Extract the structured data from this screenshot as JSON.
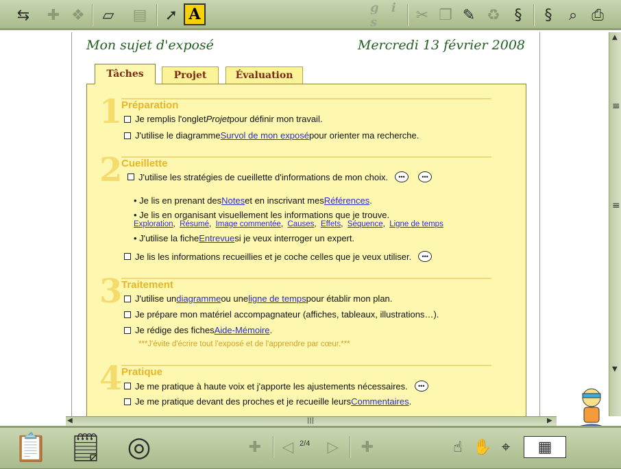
{
  "header": {
    "title": "Mon sujet d'exposé",
    "date": "Mercredi 13 février 2008"
  },
  "toolbar": {
    "highlight_label": "A",
    "format_label": "g i s"
  },
  "tabs": [
    {
      "label": "Tâches"
    },
    {
      "label": "Projet"
    },
    {
      "label": "Évaluation"
    }
  ],
  "sections": {
    "s1": {
      "num": "1",
      "title": "Préparation",
      "l1": {
        "a": "Je remplis l'onglet ",
        "b": "Projet",
        "c": " pour définir mon travail."
      },
      "l2": {
        "a": "J'utilise le diagramme ",
        "link": "Survol de mon exposé",
        "c": " pour orienter ma recherche."
      }
    },
    "s2": {
      "num": "2",
      "title": "Cueillette",
      "l1": "J'utilise les stratégies de cueillette d'informations de mon choix.",
      "b1": {
        "a": "• Je lis en prenant des ",
        "link1": "Notes",
        "b": " et en inscrivant mes ",
        "link2": "Références",
        "c": "."
      },
      "b2": "• Je lis en organisant visuellement les informations que je trouve.",
      "links": [
        "Exploration",
        "Résumé",
        "Image commentée",
        "Causes",
        "Effets",
        "Séquence",
        "Ligne de temps"
      ],
      "b3": {
        "a": "• J'utilise la fiche ",
        "link": "Entrevue",
        "c": " si je veux interroger un expert."
      },
      "l2": "Je lis les informations recueillies et je coche celles que je veux utiliser."
    },
    "s3": {
      "num": "3",
      "title": "Traitement",
      "l1": {
        "a": "J'utilise un ",
        "link1": "diagramme",
        "b": " ou une ",
        "link2": "ligne de temps",
        "c": " pour établir mon plan."
      },
      "l2": "Je prépare mon matériel accompagnateur (affiches, tableaux, illustrations…).",
      "l3": {
        "a": "Je rédige des fiches ",
        "link": "Aide-Mémoire",
        "c": "."
      },
      "note": "***J'évite d'écrire tout l'exposé et de l'apprendre par cœur.***"
    },
    "s4": {
      "num": "4",
      "title": "Pratique",
      "l1": "Je me pratique à haute voix et j'apporte les ajustements nécessaires.",
      "l2": {
        "a": "Je me pratique devant des proches et je recueille leurs ",
        "link": "Commentaires",
        "c": "."
      }
    }
  },
  "footer": {
    "page_current": "2",
    "page_total": "4"
  }
}
